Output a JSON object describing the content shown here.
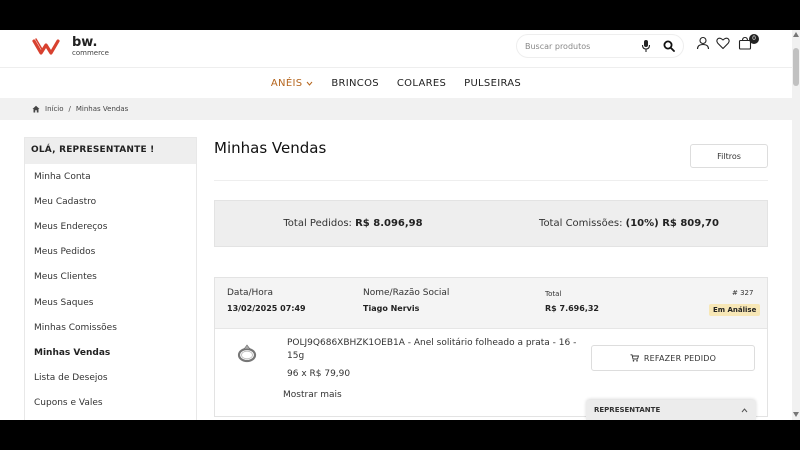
{
  "header": {
    "brand": "bw.",
    "brand_sub": "commerce",
    "search_placeholder": "Buscar produtos",
    "cart_count": "0"
  },
  "nav": {
    "items": [
      {
        "label": "ANÉIS"
      },
      {
        "label": "BRINCOS"
      },
      {
        "label": "COLARES"
      },
      {
        "label": "PULSEIRAS"
      }
    ]
  },
  "breadcrumb": {
    "home": "Início",
    "separator": "/",
    "current": "Minhas Vendas"
  },
  "sidebar": {
    "header": "OLÁ, REPRESENTANTE !",
    "items": [
      {
        "label": "Minha Conta"
      },
      {
        "label": "Meu Cadastro"
      },
      {
        "label": "Meus Endereços"
      },
      {
        "label": "Meus Pedidos"
      },
      {
        "label": "Meus Clientes"
      },
      {
        "label": "Meus Saques"
      },
      {
        "label": "Minhas Comissões"
      },
      {
        "label": "Minhas Vendas"
      },
      {
        "label": "Lista de Desejos"
      },
      {
        "label": "Cupons e Vales"
      }
    ]
  },
  "main": {
    "title": "Minhas Vendas",
    "filter_label": "Filtros",
    "summary": {
      "orders_label": "Total Pedidos:",
      "orders_value": "R$ 8.096,98",
      "commission_label": "Total Comissões:",
      "commission_value": "(10%) R$ 809,70"
    },
    "order": {
      "date_label": "Data/Hora",
      "date_value": "13/02/2025 07:49",
      "name_label": "Nome/Razão Social",
      "name_value": "Tiago Nervis",
      "total_label": "Total",
      "total_value": "R$ 7.696,32",
      "number": "# 327",
      "status": "Em Análise",
      "item_desc": "POLJ9Q686XBHZK1OEB1A - Anel solitário folheado a prata - 16 - 15g",
      "item_qty": "96 x R$ 79,90",
      "show_more": "Mostrar mais",
      "reorder_label": "REFAZER PEDIDO"
    }
  },
  "widget": {
    "label": "REPRESENTANTE"
  },
  "colors": {
    "accent": "#b5651d",
    "logo_red": "#d8412f",
    "badge_bg": "#f7e7b6"
  }
}
